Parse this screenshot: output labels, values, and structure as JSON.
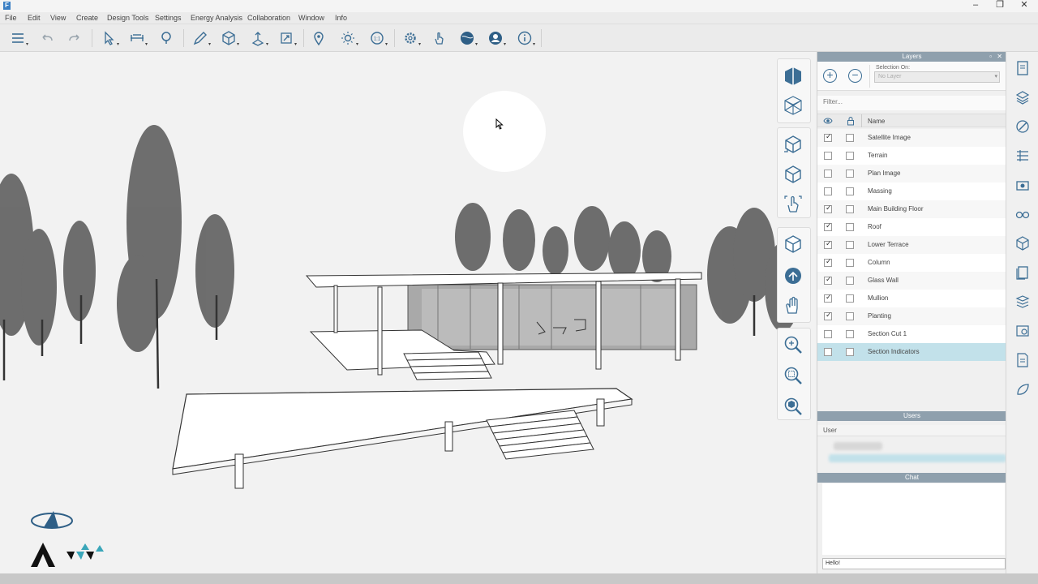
{
  "app": {
    "logo_letter": "F"
  },
  "window_controls": {
    "minimize": "–",
    "restore": "❐",
    "close": "✕"
  },
  "menu": [
    "File",
    "Edit",
    "View",
    "Create",
    "Design Tools",
    "Settings",
    "Energy Analysis",
    "Collaboration",
    "Window",
    "Info"
  ],
  "toolbar_icons": [
    "layers-menu-icon",
    "undo-icon",
    "redo-icon",
    "select-icon",
    "measure-icon",
    "hint-icon",
    "sketch-icon",
    "shape-icon",
    "extrude-icon",
    "transform-icon",
    "location-pin-icon",
    "sun-icon",
    "scale-icon",
    "settings-gear-icon",
    "touch-icon",
    "globe-icon",
    "user-icon",
    "info-icon"
  ],
  "layers_panel": {
    "title": "Layers",
    "selection_on_label": "Selection On:",
    "selection_on_value": "No Layer",
    "filter_placeholder": "Filter...",
    "name_header": "Name",
    "layers": [
      {
        "name": "Satellite Image",
        "visible": true,
        "locked": false
      },
      {
        "name": "Terrain",
        "visible": false,
        "locked": false
      },
      {
        "name": "Plan Image",
        "visible": false,
        "locked": false
      },
      {
        "name": "Massing",
        "visible": false,
        "locked": false
      },
      {
        "name": "Main Building Floor",
        "visible": true,
        "locked": false
      },
      {
        "name": "Roof",
        "visible": true,
        "locked": false
      },
      {
        "name": "Lower Terrace",
        "visible": true,
        "locked": false
      },
      {
        "name": "Column",
        "visible": true,
        "locked": false
      },
      {
        "name": "Glass Wall",
        "visible": true,
        "locked": false
      },
      {
        "name": "Mullion",
        "visible": true,
        "locked": false
      },
      {
        "name": "Planting",
        "visible": true,
        "locked": false
      },
      {
        "name": "Section Cut  1",
        "visible": false,
        "locked": false
      },
      {
        "name": "Section Indicators",
        "visible": false,
        "locked": false,
        "selected": true
      }
    ]
  },
  "users_panel": {
    "title": "Users",
    "column_label": "User"
  },
  "chat_panel": {
    "title": "Chat",
    "input_value": "Hello!"
  },
  "colors": {
    "accent": "#3c6e95",
    "panel_header": "#8fa0ad",
    "selected_row": "#c2e1ea"
  }
}
